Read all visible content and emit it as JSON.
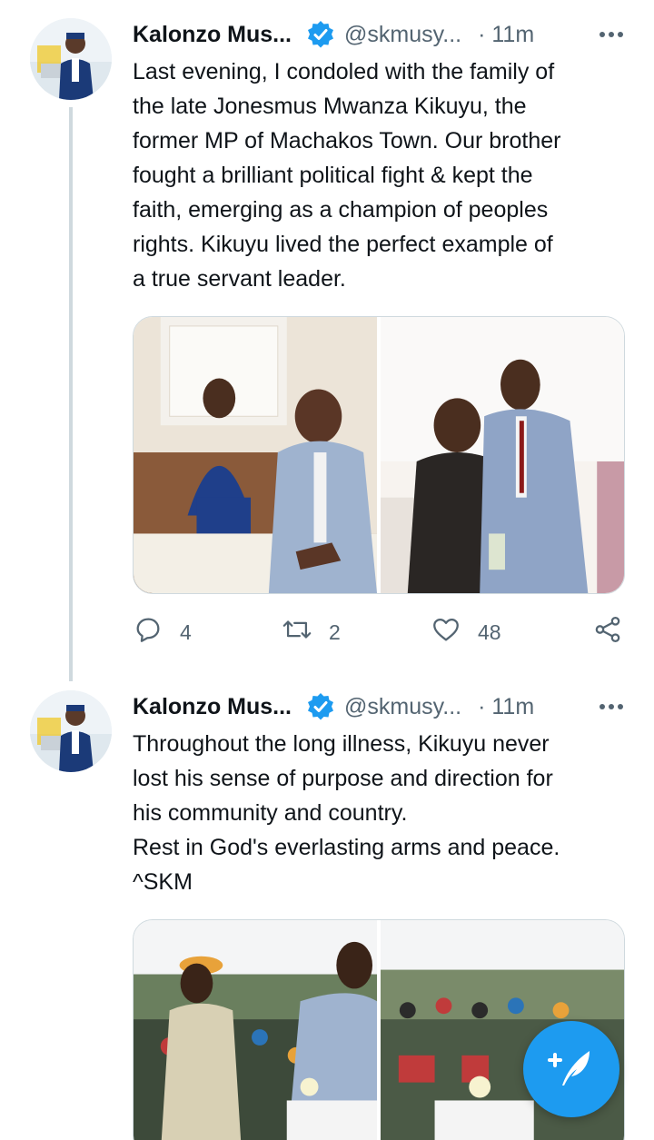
{
  "thread": [
    {
      "author_name": "Kalonzo Mus...",
      "handle": "@skmusy...",
      "time": "· 11m",
      "text_lines": [
        "Last evening, I condoled with the family of",
        "the late Jonesmus Mwanza Kikuyu, the",
        "former MP of Machakos Town. Our brother",
        "fought a brilliant political fight & kept the",
        "faith, emerging as a champion of peoples",
        "rights. Kikuyu lived the perfect example of",
        "a true servant leader."
      ],
      "replies": "4",
      "retweets": "2",
      "likes": "48",
      "photos": [
        "condolence-book-signing-photo",
        "greeting-handshake-photo"
      ]
    },
    {
      "author_name": "Kalonzo Mus...",
      "handle": "@skmusy...",
      "time": "· 11m",
      "text_lines": [
        "Throughout the long illness, Kikuyu never",
        "lost his sense of purpose and direction for",
        "his community and country.",
        "Rest in God's everlasting arms and peace.",
        "^SKM"
      ],
      "photos": [
        "elder-handshake-photo",
        "tent-gathering-photo"
      ]
    }
  ],
  "icons": {
    "verified": "verified-badge-icon",
    "more": "more-dots-icon",
    "reply": "reply-icon",
    "retweet": "retweet-icon",
    "like": "heart-icon",
    "share": "share-icon",
    "compose": "compose-tweet-icon"
  },
  "colors": {
    "accent": "#1d9bf0",
    "secondary_text": "#536471",
    "primary_text": "#0f1419",
    "thread_line": "#cfd9de"
  }
}
